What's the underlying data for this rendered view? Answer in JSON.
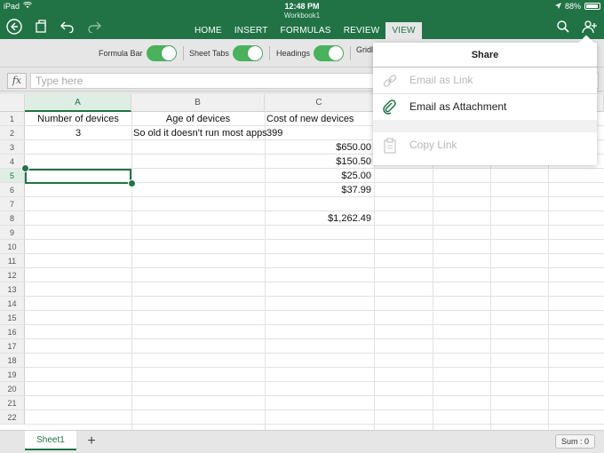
{
  "status": {
    "device": "iPad",
    "time": "12:48 PM",
    "battery": "88%"
  },
  "workbook": {
    "name": "Workbook1"
  },
  "tabs": [
    {
      "label": "HOME",
      "active": false
    },
    {
      "label": "INSERT",
      "active": false
    },
    {
      "label": "FORMULAS",
      "active": false
    },
    {
      "label": "REVIEW",
      "active": false
    },
    {
      "label": "VIEW",
      "active": true
    }
  ],
  "ribbon": {
    "toggles": [
      {
        "label": "Formula Bar",
        "on": true
      },
      {
        "label": "Sheet Tabs",
        "on": true
      },
      {
        "label": "Headings",
        "on": true
      },
      {
        "label": "Gridl",
        "on": true
      }
    ]
  },
  "formula_bar": {
    "fx_label": "fx",
    "placeholder": "Type here"
  },
  "columns": [
    "A",
    "B",
    "C"
  ],
  "selected_column": "A",
  "rows": [
    "1",
    "2",
    "3",
    "4",
    "5",
    "6",
    "7",
    "8",
    "9",
    "10",
    "11",
    "12",
    "13",
    "14",
    "15",
    "16",
    "17",
    "18",
    "19",
    "20",
    "21",
    "22"
  ],
  "selected_row": "5",
  "cells": {
    "A1": "Number of devices",
    "B1": "Age of devices",
    "C1": "Cost of new devices",
    "A2": "3",
    "B2": "So old it doesn't run most apps",
    "C2": "399",
    "C3": "$650.00",
    "C4": "$150.50",
    "C5": "$25.00",
    "C6": "$37.99",
    "C8": "$1,262.49"
  },
  "share": {
    "title": "Share",
    "items": [
      {
        "label": "Email as Link",
        "icon": "link-icon",
        "enabled": false
      },
      {
        "label": "Email as Attachment",
        "icon": "paperclip-icon",
        "enabled": true
      },
      {
        "label": "Copy Link",
        "icon": "clipboard-icon",
        "enabled": false
      }
    ]
  },
  "bottom": {
    "sheet_name": "Sheet1",
    "add_label": "+",
    "sum_label": "Sum : 0"
  },
  "colors": {
    "brand_green": "#217346",
    "toggle_green": "#4ab15c"
  }
}
